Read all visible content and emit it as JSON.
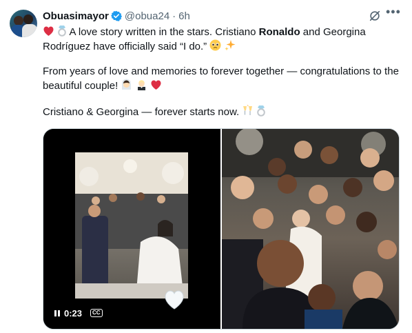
{
  "author": {
    "name": "Obuasimayor",
    "handle": "@obua24",
    "separator": "·",
    "time": "6h"
  },
  "tweet": {
    "line1_pre": "A love story written in the stars. Cristiano ",
    "line1_bold": "Ronaldo",
    "line1_post": " and Georgina Rodríguez have officially said “I do.”",
    "line2": "From years of love and memories to forever together — congratulations to the beautiful couple!",
    "line3": "Cristiano & Georgina — forever starts now."
  },
  "video": {
    "duration": "0:23",
    "captions_label": "CC"
  },
  "icons": {
    "verified": "verified-badge-icon",
    "grok": "grok-icon",
    "more": "more-icon",
    "heart": "red-heart-emoji-icon",
    "ring": "ring-emoji-icon",
    "pleading": "pleading-face-emoji-icon",
    "sparkles": "sparkles-emoji-icon",
    "bride": "bride-emoji-icon",
    "groom": "groom-emoji-icon",
    "clink": "clinking-glasses-emoji-icon"
  },
  "colors": {
    "verified": "#1d9bf0",
    "text": "#0f1419",
    "secondary": "#536471",
    "heart": "#e0245e"
  }
}
